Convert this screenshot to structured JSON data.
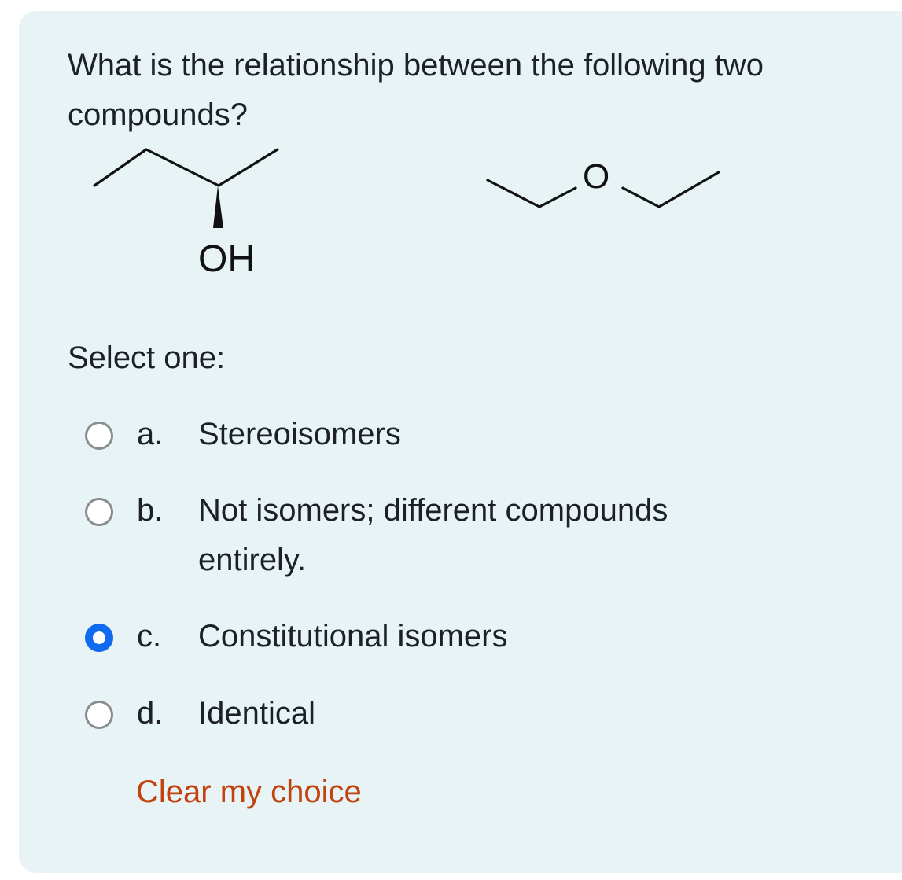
{
  "question": {
    "text": "What is the relationship between the following two compounds?"
  },
  "compounds": {
    "left_label": "OH",
    "right_label": "O"
  },
  "prompt": "Select one:",
  "options": [
    {
      "letter": "a.",
      "text": "Stereoisomers",
      "selected": false
    },
    {
      "letter": "b.",
      "text": "Not isomers; different compounds entirely.",
      "selected": false
    },
    {
      "letter": "c.",
      "text": "Constitutional isomers",
      "selected": true
    },
    {
      "letter": "d.",
      "text": "Identical",
      "selected": false
    }
  ],
  "clear_choice": "Clear my choice",
  "colors": {
    "card_background": "#e7f3f5",
    "radio_selected": "#0f6cf0",
    "link": "#c2410c"
  }
}
